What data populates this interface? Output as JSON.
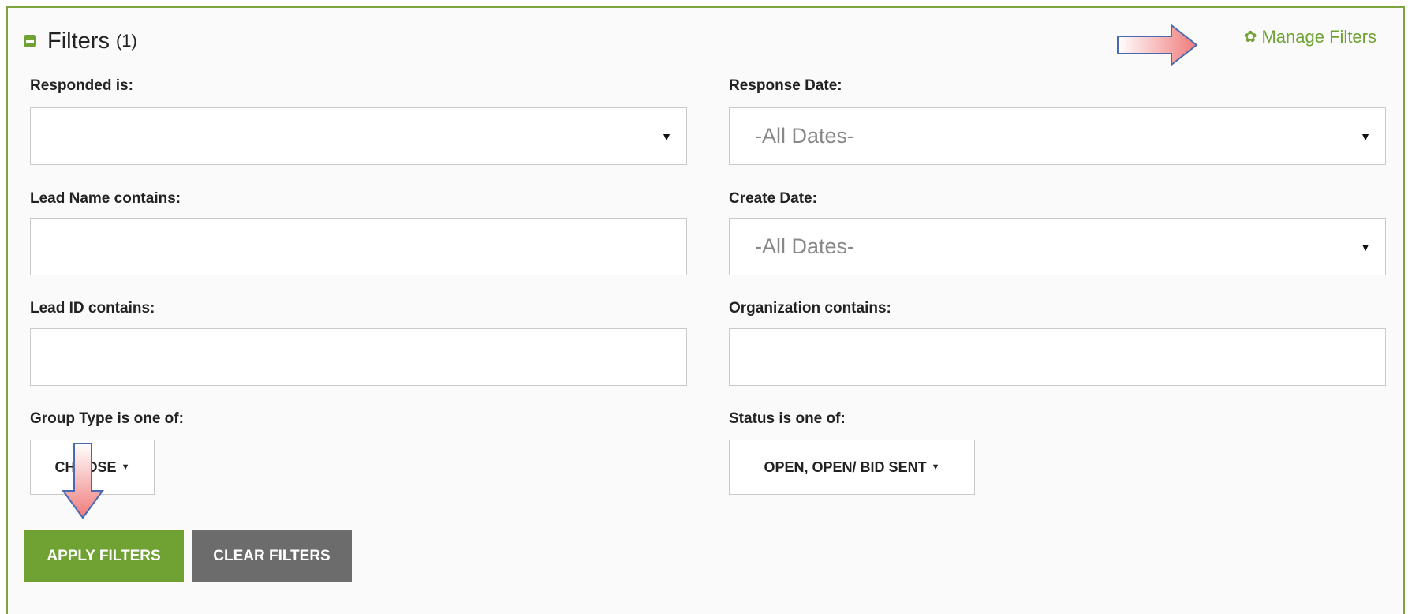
{
  "header": {
    "title": "Filters",
    "count": "(1)",
    "manage_label": "Manage Filters"
  },
  "icons": {
    "collapse": "minus-square-icon",
    "manage": "gear-icon",
    "accent": "#6fa233"
  },
  "fields": {
    "responded": {
      "label": "Responded is:",
      "value": ""
    },
    "response_date": {
      "label": "Response Date:",
      "value": "-All Dates-"
    },
    "lead_name": {
      "label": "Lead Name contains:",
      "value": "",
      "placeholder": ""
    },
    "create_date": {
      "label": "Create Date:",
      "value": "-All Dates-"
    },
    "lead_id": {
      "label": "Lead ID contains:",
      "value": "",
      "placeholder": ""
    },
    "organization": {
      "label": "Organization contains:",
      "value": "",
      "placeholder": ""
    },
    "group_type": {
      "label": "Group Type is one of:",
      "value": "CHOOSE"
    },
    "status": {
      "label": "Status is one of:",
      "value": "OPEN, OPEN/ BID SENT"
    }
  },
  "buttons": {
    "apply": "APPLY FILTERS",
    "clear": "CLEAR FILTERS"
  }
}
